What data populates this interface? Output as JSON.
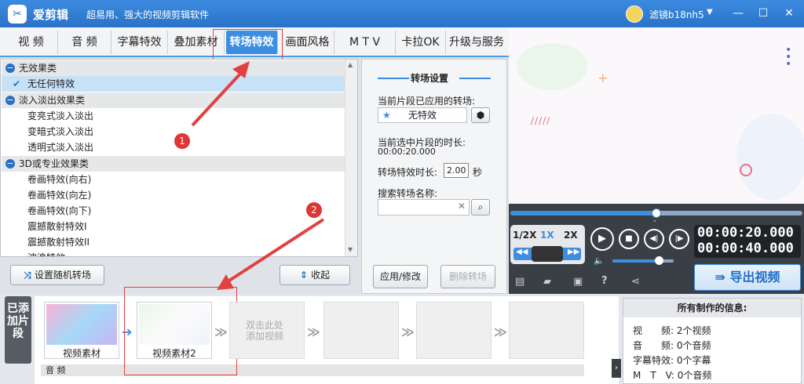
{
  "app": {
    "name": "爱剪辑",
    "slogan": "超易用、强大的视频剪辑软件",
    "user": "滤镜b18nh5"
  },
  "tabs": [
    "视 频",
    "音 频",
    "字幕特效",
    "叠加素材",
    "转场特效",
    "画面风格",
    "M T V",
    "卡拉OK",
    "升级与服务"
  ],
  "active_tab": "转场特效",
  "effects": {
    "cat1": "无效果类",
    "item_none": "无任何特效",
    "cat2": "淡入淡出效果类",
    "fade": [
      "变亮式淡入淡出",
      "变暗式淡入淡出",
      "透明式淡入淡出"
    ],
    "cat3": "3D或专业效果类",
    "pro": [
      "卷画特效(向右)",
      "卷画特效(向左)",
      "卷画特效(向下)",
      "震撼散射特效I",
      "震撼散射特效II",
      "波浪特效"
    ]
  },
  "settings": {
    "title": "转场设置",
    "applied_label": "当前片段已应用的转场:",
    "applied_value": "无特效",
    "duration_label": "当前选中片段的时长:",
    "duration_value": "00:00:20.000",
    "effect_len_label": "转场特效时长:",
    "effect_len_value": "2.00",
    "effect_len_unit": "秒",
    "search_label": "搜索转场名称:",
    "search_value": "",
    "apply_btn": "应用/修改",
    "delete_btn": "删除转场"
  },
  "buttons": {
    "random": "设置随机转场",
    "collapse": "收起",
    "export": "导出视频"
  },
  "player": {
    "speed": [
      "1/2X",
      "1X",
      "2X"
    ],
    "active_speed": "1X",
    "time_current": "00:00:20.000",
    "time_total": "00:00:40.000",
    "progress": 0.5,
    "volume": 0.75
  },
  "timeline": {
    "sidebar": "已添加片段",
    "clips": [
      "视频素材",
      "视频素材2"
    ],
    "empty_hint": "双击此处添加视频",
    "audio_label": "音 频"
  },
  "info": {
    "title": "所有制作的信息:",
    "rows": [
      {
        "k": "视　　频:",
        "v": "2个视频"
      },
      {
        "k": "音　　频:",
        "v": "0个音频"
      },
      {
        "k": "字幕特效:",
        "v": "0个字幕"
      },
      {
        "k": "M　T　V:",
        "v": "0个音频"
      }
    ]
  },
  "annotations": [
    "1",
    "2"
  ],
  "colors": {
    "accent": "#3d8de0",
    "annotation": "#e34040"
  }
}
